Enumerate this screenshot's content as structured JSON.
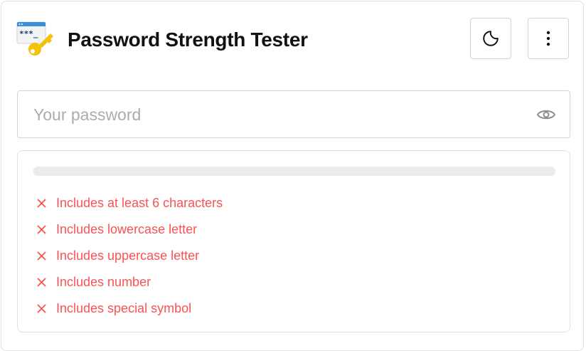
{
  "header": {
    "title": "Password Strength Tester",
    "theme_icon": "moon-icon",
    "menu_icon": "dots-vertical-icon"
  },
  "password": {
    "placeholder": "Your password",
    "value": "",
    "visibility_icon": "eye-icon"
  },
  "strength": {
    "level": 0
  },
  "requirements": [
    {
      "label": "Includes at least 6 characters",
      "met": false,
      "icon": "x-icon"
    },
    {
      "label": "Includes lowercase letter",
      "met": false,
      "icon": "x-icon"
    },
    {
      "label": "Includes uppercase letter",
      "met": false,
      "icon": "x-icon"
    },
    {
      "label": "Includes number",
      "met": false,
      "icon": "x-icon"
    },
    {
      "label": "Includes special symbol",
      "met": false,
      "icon": "x-icon"
    }
  ],
  "colors": {
    "fail": "#fa5252",
    "track": "#e9ecef",
    "border": "#ced4da",
    "key_gold": "#f4c20d",
    "window_blue": "#3b8fd9"
  }
}
